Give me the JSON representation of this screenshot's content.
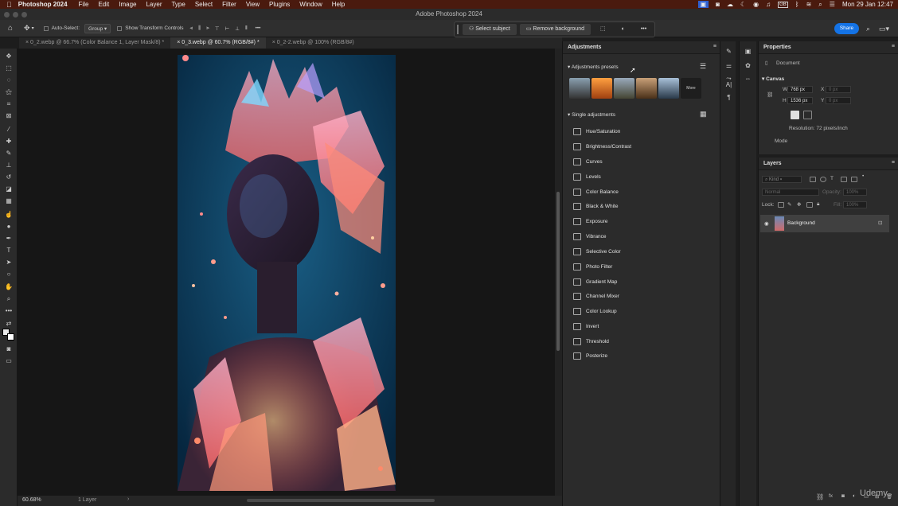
{
  "menubar": {
    "apple": "",
    "app": "Photoshop 2024",
    "items": [
      "File",
      "Edit",
      "Image",
      "Layer",
      "Type",
      "Select",
      "Filter",
      "View",
      "Plugins",
      "Window",
      "Help"
    ],
    "clock": "Mon 29 Jan 12:47",
    "gb_badge": "GB"
  },
  "window": {
    "title": "Adobe Photoshop 2024"
  },
  "options_bar": {
    "auto_select_label": "Auto-Select:",
    "group_value": "Group",
    "transform_label": "Show Transform Controls"
  },
  "context_bar": {
    "select_subject": "Select subject",
    "remove_background": "Remove background"
  },
  "share_label": "Share",
  "tabs": [
    {
      "label": "0_2.webp @ 66.7% (Color Balance 1, Layer Mask/8) *"
    },
    {
      "label": "0_3.webp @ 60.7% (RGB/8#) *"
    },
    {
      "label": "0_2-2.webp @ 100% (RGB/8#)"
    }
  ],
  "status": {
    "zoom": "60.68%",
    "layers": "1 Layer"
  },
  "adjustments": {
    "title": "Adjustments",
    "presets_label": "Adjustments presets",
    "more_label": "More",
    "single_label": "Single adjustments",
    "items": [
      "Hue/Saturation",
      "Brightness/Contrast",
      "Curves",
      "Levels",
      "Color Balance",
      "Black & White",
      "Exposure",
      "Vibrance",
      "Selective Color",
      "Photo Filter",
      "Gradient Map",
      "Channel Mixer",
      "Color Lookup",
      "Invert",
      "Threshold",
      "Posterize"
    ]
  },
  "properties": {
    "title": "Properties",
    "document_label": "Document",
    "canvas_label": "Canvas",
    "w_label": "W",
    "h_label": "H",
    "x_label": "X",
    "y_label": "Y",
    "width": "768 px",
    "height": "1536 px",
    "x_value": "0 px",
    "y_value": "0 px",
    "resolution": "Resolution: 72 pixels/inch",
    "mode_label": "Mode"
  },
  "layers": {
    "title": "Layers",
    "kind": "Kind",
    "blend": "Normal",
    "opacity_label": "Opacity:",
    "opacity": "100%",
    "lock_label": "Lock:",
    "fill_label": "Fill:",
    "fill": "100%",
    "items": [
      {
        "name": "Background"
      }
    ]
  },
  "watermark": "Udemy",
  "colors": {
    "menubar": "#4a1a0e",
    "accent": "#1473e6"
  }
}
